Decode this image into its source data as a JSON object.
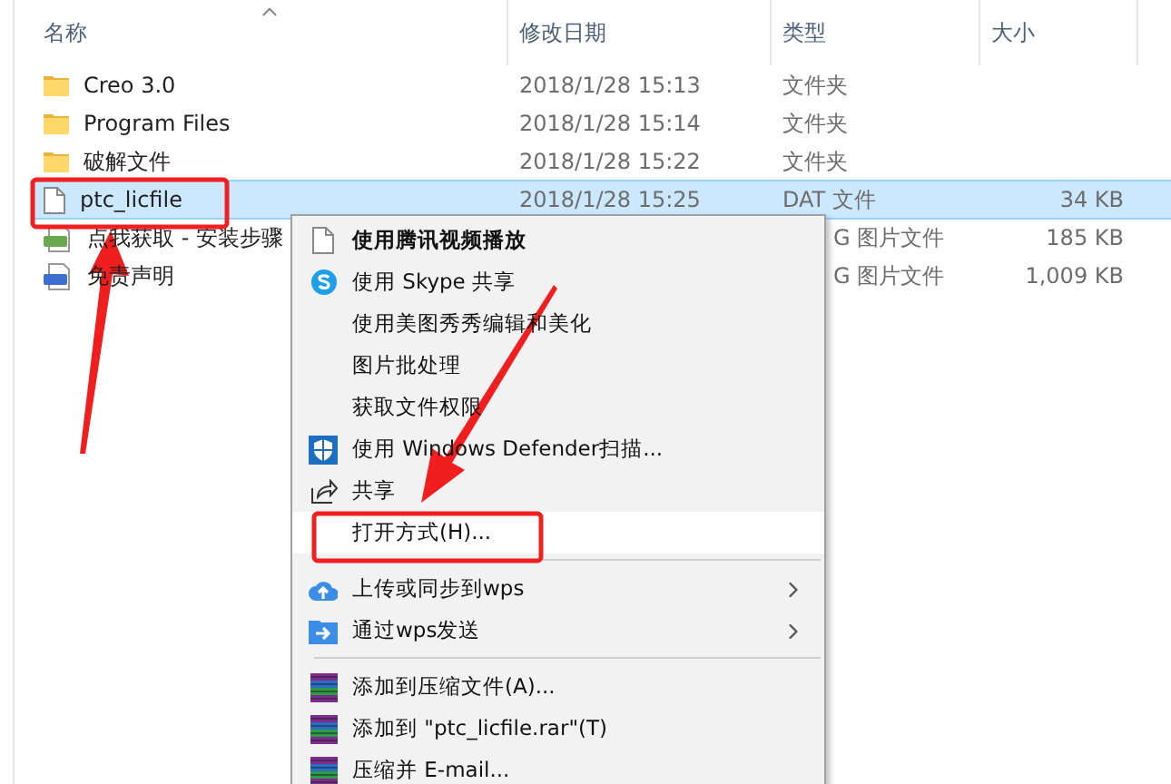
{
  "columns": [
    {
      "label": "名称",
      "sorted": true
    },
    {
      "label": "修改日期",
      "sorted": false
    },
    {
      "label": "类型",
      "sorted": false
    },
    {
      "label": "大小",
      "sorted": false
    }
  ],
  "files": [
    {
      "kind": "folder",
      "name": "Creo 3.0",
      "date": "2018/1/28 15:13",
      "type": "文件夹",
      "selected": false
    },
    {
      "kind": "folder",
      "name": "Program Files",
      "date": "2018/1/28 15:14",
      "type": "文件夹",
      "selected": false
    },
    {
      "kind": "folder",
      "name": "破解文件",
      "date": "2018/1/28 15:22",
      "type": "文件夹",
      "selected": false
    },
    {
      "kind": "file",
      "name": "ptc_licfile",
      "date": "2018/1/28 15:25",
      "type": "DAT 文件",
      "size": "34 KB",
      "selected": true
    },
    {
      "kind": "png",
      "name": "点我获取 - 安装步骤",
      "type": "G 图片文件",
      "size": "185 KB",
      "selected": false
    },
    {
      "kind": "jpg",
      "name": "免责声明",
      "type": "G 图片文件",
      "size": "1,009 KB",
      "selected": false
    }
  ],
  "context_menu": {
    "groups": [
      [
        {
          "kind": "file",
          "label": "使用腾讯视频播放",
          "bold": true,
          "submenu": false,
          "selected": false
        },
        {
          "kind": "skype",
          "label": "使用 Skype 共享",
          "bold": false,
          "submenu": false,
          "selected": false
        },
        {
          "kind": "plain",
          "label": "使用美图秀秀编辑和美化",
          "bold": false,
          "submenu": false,
          "selected": false
        },
        {
          "kind": "plain",
          "label": "图片批处理",
          "bold": false,
          "submenu": false,
          "selected": false
        },
        {
          "kind": "plain",
          "label": "获取文件权限",
          "bold": false,
          "submenu": false,
          "selected": false
        },
        {
          "kind": "shield",
          "label": "使用 Windows Defender扫描...",
          "bold": false,
          "submenu": false,
          "selected": false
        },
        {
          "kind": "share",
          "label": "共享",
          "bold": false,
          "submenu": false,
          "selected": false
        },
        {
          "kind": "plain",
          "label": "打开方式(H)...",
          "bold": false,
          "submenu": false,
          "selected": true
        }
      ],
      [
        {
          "kind": "cloud",
          "label": "上传或同步到wps",
          "bold": false,
          "submenu": true,
          "selected": false
        },
        {
          "kind": "send",
          "label": "通过wps发送",
          "bold": false,
          "submenu": true,
          "selected": false
        }
      ],
      [
        {
          "kind": "archive",
          "label": "添加到压缩文件(A)...",
          "bold": false,
          "submenu": false,
          "selected": false
        },
        {
          "kind": "archive",
          "label": "添加到 \"ptc_licfile.rar\"(T)",
          "bold": false,
          "submenu": false,
          "selected": false
        },
        {
          "kind": "archive",
          "label": "压缩并 E-mail...",
          "bold": false,
          "submenu": false,
          "selected": false
        }
      ]
    ]
  }
}
